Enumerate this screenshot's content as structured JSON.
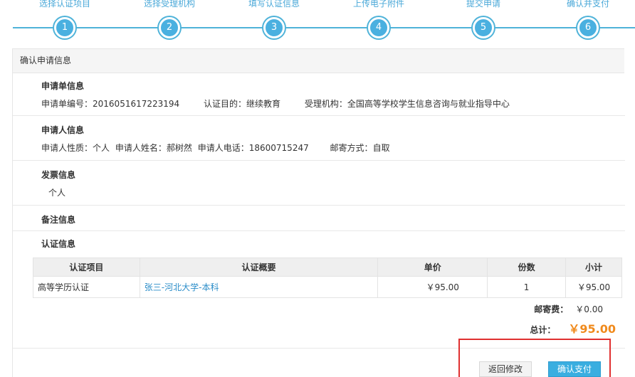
{
  "steps": [
    {
      "label": "选择认证项目",
      "number": "1"
    },
    {
      "label": "选择受理机构",
      "number": "2"
    },
    {
      "label": "填写认证信息",
      "number": "3"
    },
    {
      "label": "上传电子附件",
      "number": "4"
    },
    {
      "label": "提交申请",
      "number": "5"
    },
    {
      "label": "确认并支付",
      "number": "6"
    }
  ],
  "panel": {
    "title": "确认申请信息"
  },
  "application_info": {
    "title": "申请单信息",
    "number_label": "申请单编号：",
    "number_value": "2016051617223194",
    "purpose_label": "认证目的：",
    "purpose_value": "继续教育",
    "agency_label": "受理机构：",
    "agency_value": "全国高等学校学生信息咨询与就业指导中心"
  },
  "applicant_info": {
    "title": "申请人信息",
    "nature_label": "申请人性质：",
    "nature_value": "个人",
    "name_label": "申请人姓名：",
    "name_value": "郝树然",
    "phone_label": "申请人电话：",
    "phone_value": "18600715247",
    "mail_label": "邮寄方式：",
    "mail_value": "自取"
  },
  "invoice_info": {
    "title": "发票信息",
    "value": "个人"
  },
  "remark_info": {
    "title": "备注信息"
  },
  "cert_info": {
    "title": "认证信息",
    "headers": [
      "认证项目",
      "认证概要",
      "单价",
      "份数",
      "小计"
    ],
    "rows": [
      {
        "item": "高等学历认证",
        "summary": "张三-河北大学-本科",
        "price": "￥95.00",
        "qty": "1",
        "subtotal": "￥95.00"
      }
    ]
  },
  "fees": {
    "postage_label": "邮寄费：",
    "postage_value": "￥0.00",
    "total_label": "总计：",
    "total_value": "￥95.00"
  },
  "actions": {
    "back_label": "返回修改",
    "pay_label": "确认支付"
  },
  "colors": {
    "accent": "#4ab0e0",
    "link": "#2b8dc9",
    "total": "#f08a1c",
    "highlight": "#e03030"
  }
}
